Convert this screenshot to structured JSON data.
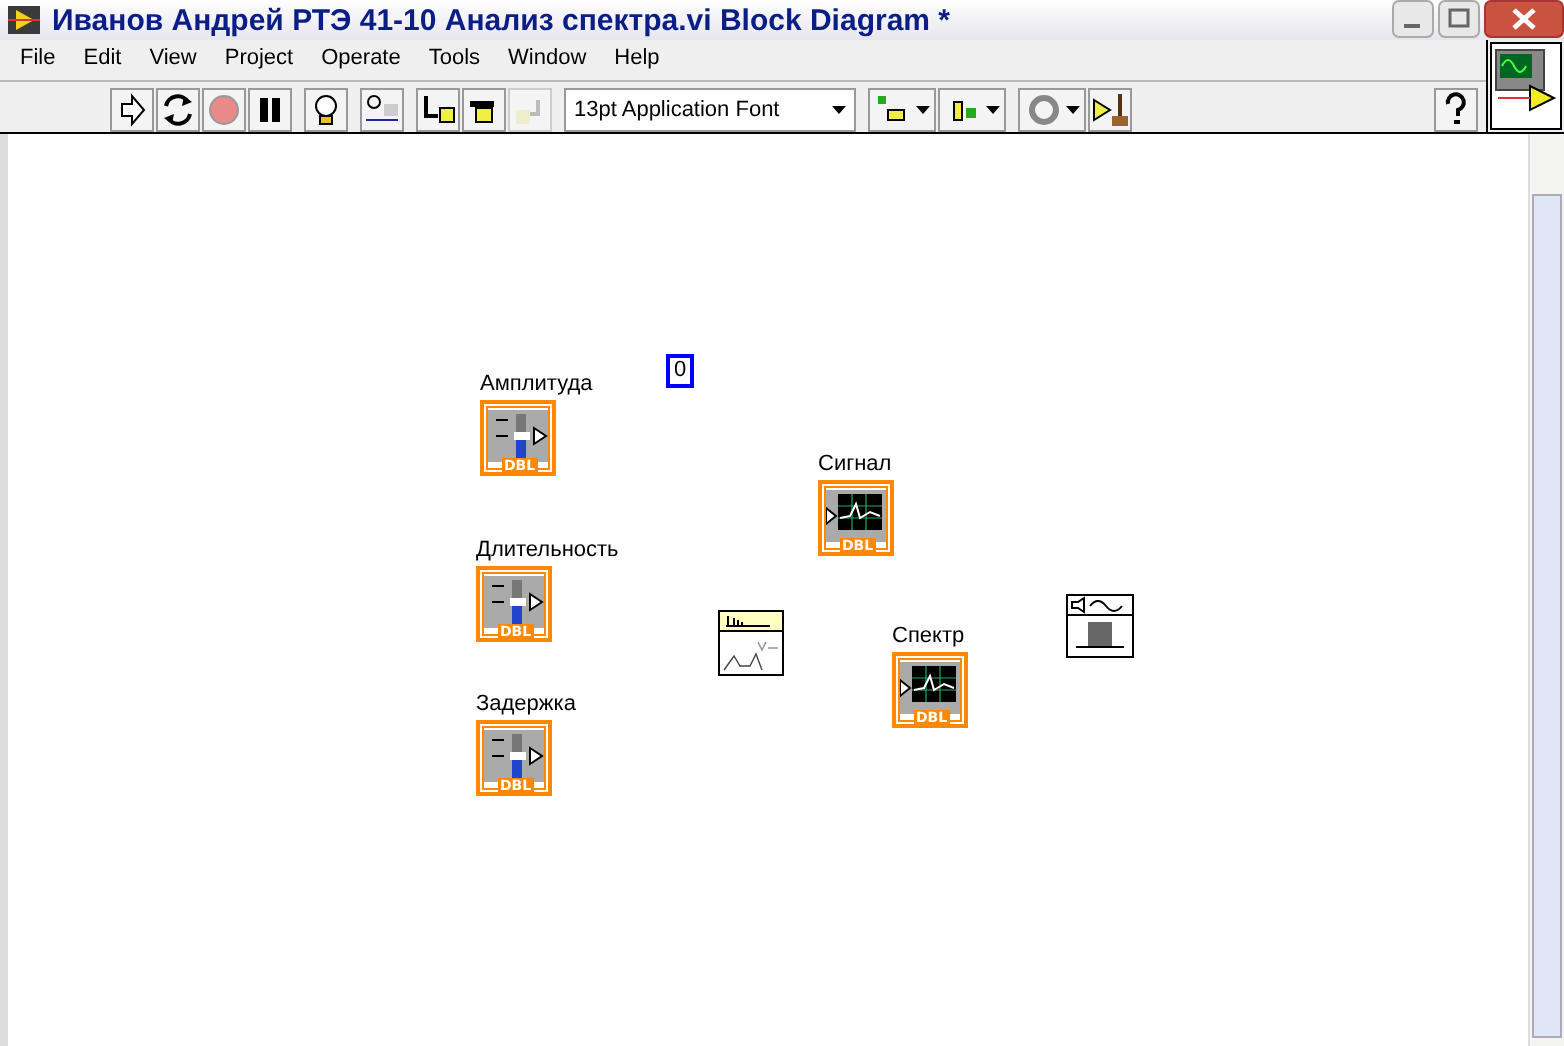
{
  "window": {
    "title": "Иванов Андрей РТЭ 41-10 Анализ спектра.vi Block Diagram *"
  },
  "menu": [
    "File",
    "Edit",
    "View",
    "Project",
    "Operate",
    "Tools",
    "Window",
    "Help"
  ],
  "toolbar": {
    "font": "13pt Application Font"
  },
  "canvas": {
    "nodes": [
      {
        "kind": "control",
        "label": "Амплитуда",
        "type": "DBL"
      },
      {
        "kind": "control",
        "label": "Длительность",
        "type": "DBL"
      },
      {
        "kind": "control",
        "label": "Задержка",
        "type": "DBL"
      },
      {
        "kind": "constant",
        "value": "0"
      },
      {
        "kind": "indicator",
        "label": "Сигнал",
        "type": "DBL"
      },
      {
        "kind": "spectral"
      },
      {
        "kind": "indicator",
        "label": "Спектр",
        "type": "DBL"
      },
      {
        "kind": "sound"
      }
    ]
  }
}
